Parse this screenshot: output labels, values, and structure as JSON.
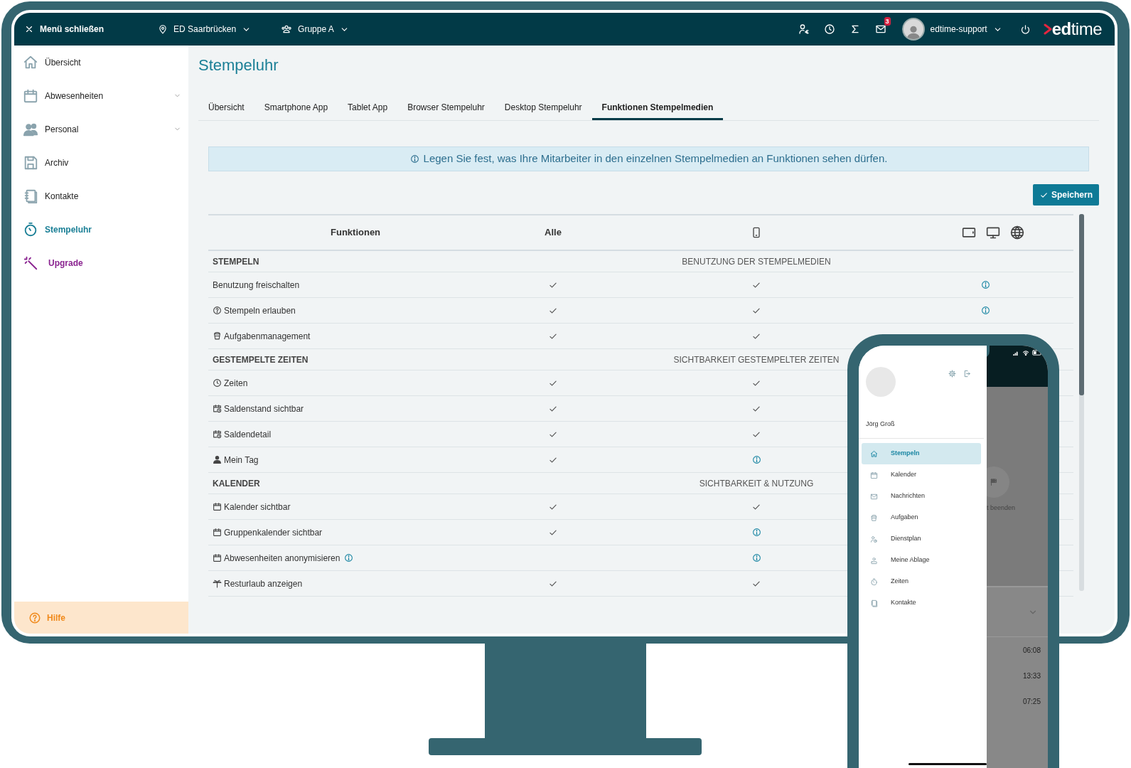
{
  "topbar": {
    "close_label": "Menü schließen",
    "location": "ED Saarbrücken",
    "group": "Gruppe A",
    "mail_badge": "3",
    "user": "edtime-support",
    "logo": "**ed**time"
  },
  "sidebar": {
    "items": [
      {
        "label": "Übersicht",
        "kind": "item",
        "selected": false,
        "expandable": false
      },
      {
        "label": "Abwesenheiten",
        "kind": "item",
        "selected": false,
        "expandable": true
      },
      {
        "label": "Personal",
        "kind": "item",
        "selected": false,
        "expandable": true
      },
      {
        "label": "Archiv",
        "kind": "item",
        "selected": false,
        "expandable": false
      },
      {
        "label": "Kontakte",
        "kind": "item",
        "selected": false,
        "expandable": false
      },
      {
        "label": "Stempeluhr",
        "kind": "item",
        "selected": true,
        "expandable": false
      },
      {
        "label": "Upgrade",
        "kind": "upgrade",
        "selected": false,
        "expandable": false
      }
    ],
    "help": "Hilfe"
  },
  "page": {
    "title": "Stempeluhr",
    "tabs": [
      {
        "label": "Übersicht",
        "selected": false
      },
      {
        "label": "Smartphone App",
        "selected": false
      },
      {
        "label": "Tablet App",
        "selected": false
      },
      {
        "label": "Browser Stempeluhr",
        "selected": false
      },
      {
        "label": "Desktop Stempeluhr",
        "selected": false
      },
      {
        "label": "Funktionen Stempelmedien",
        "selected": true
      }
    ],
    "info": "Legen Sie fest, was Ihre Mitarbeiter in den einzelnen Stempelmedien an Funktionen sehen dürfen.",
    "save": "Speichern"
  },
  "table": {
    "columns": [
      "Funktionen",
      "Alle"
    ],
    "sections": [
      {
        "title": "STEMPELN",
        "note": "BENUTZUNG DER STEMPELMEDIEN",
        "rows": [
          {
            "label": "Benutzung freischalten",
            "info": false,
            "cells": [
              {
                "kind": "check"
              },
              {
                "kind": "check"
              },
              {
                "kind": "info"
              }
            ]
          },
          {
            "label": "Stempeln erlauben",
            "info": false,
            "cells": [
              {
                "kind": "check"
              },
              {
                "kind": "check"
              },
              {
                "kind": "info"
              }
            ]
          },
          {
            "label": "Aufgabenmanagement",
            "info": false,
            "cells": [
              {
                "kind": "check"
              },
              {
                "kind": "check"
              }
            ]
          }
        ]
      },
      {
        "title": "GESTEMPELTE ZEITEN",
        "note": "SICHTBARKEIT GESTEMPELTER ZEITEN",
        "rows": [
          {
            "label": "Zeiten",
            "info": false,
            "cells": [
              {
                "kind": "check"
              },
              {
                "kind": "check"
              }
            ]
          },
          {
            "label": "Saldenstand sichtbar",
            "info": false,
            "cells": [
              {
                "kind": "check"
              },
              {
                "kind": "check"
              }
            ]
          },
          {
            "label": "Saldendetail",
            "info": false,
            "cells": [
              {
                "kind": "check"
              },
              {
                "kind": "check"
              }
            ]
          },
          {
            "label": "Mein Tag",
            "info": false,
            "cells": [
              {
                "kind": "check"
              },
              {
                "kind": "info"
              }
            ]
          }
        ]
      },
      {
        "title": "KALENDER",
        "note": "SICHTBARKEIT & NUTZUNG",
        "rows": [
          {
            "label": "Kalender sichtbar",
            "info": false,
            "cells": [
              {
                "kind": "check"
              },
              {
                "kind": "check"
              }
            ]
          },
          {
            "label": "Gruppenkalender sichtbar",
            "info": false,
            "cells": [
              {
                "kind": "check"
              },
              {
                "kind": "info"
              }
            ]
          },
          {
            "label": "Abwesenheiten anonymisieren",
            "info": true,
            "cells": [
              {
                "kind": "blank"
              },
              {
                "kind": "info"
              }
            ]
          },
          {
            "label": "Resturlaub anzeigen",
            "info": false,
            "cells": [
              {
                "kind": "check"
              },
              {
                "kind": "check"
              }
            ]
          }
        ]
      }
    ]
  },
  "phone": {
    "user": "Jörg Groß",
    "menu": [
      {
        "label": "Stempeln",
        "selected": true
      },
      {
        "label": "Kalender",
        "selected": false
      },
      {
        "label": "Nachrichten",
        "selected": false
      },
      {
        "label": "Aufgaben",
        "selected": false
      },
      {
        "label": "Dienstplan",
        "selected": false
      },
      {
        "label": "Meine Ablage",
        "selected": false
      },
      {
        "label": "Zeiten",
        "selected": false
      },
      {
        "label": "Kontakte",
        "selected": false
      }
    ],
    "behind": {
      "action": "t beenden",
      "times": [
        "06:08",
        "13:33",
        "07:25"
      ]
    }
  }
}
